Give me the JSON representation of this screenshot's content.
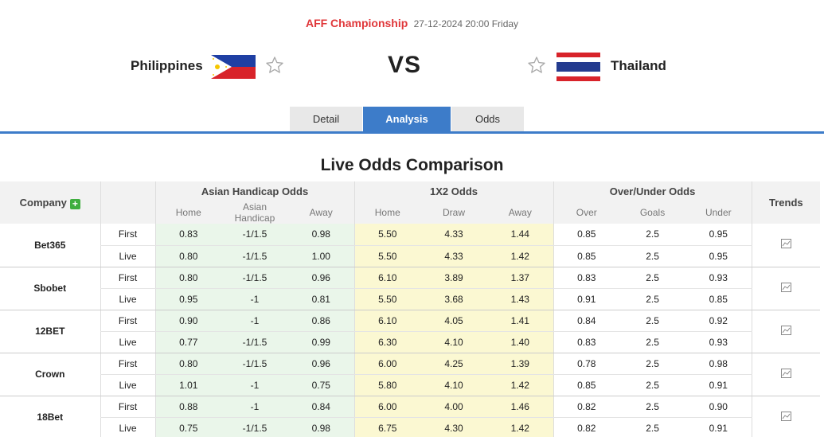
{
  "match": {
    "league": "AFF Championship",
    "datetime": "27-12-2024 20:00 Friday",
    "home_team": "Philippines",
    "away_team": "Thailand",
    "vs": "VS"
  },
  "tabs": [
    {
      "label": "Detail",
      "active": false
    },
    {
      "label": "Analysis",
      "active": true
    },
    {
      "label": "Odds",
      "active": false
    }
  ],
  "section_title": "Live Odds Comparison",
  "table": {
    "company_header": "Company",
    "trends_header": "Trends",
    "groups": {
      "asian_handicap": "Asian Handicap Odds",
      "x12": "1X2 Odds",
      "over_under": "Over/Under Odds"
    },
    "subheaders": {
      "ah": [
        "Home",
        "Asian Handicap",
        "Away"
      ],
      "x12": [
        "Home",
        "Draw",
        "Away"
      ],
      "ou": [
        "Over",
        "Goals",
        "Under"
      ]
    },
    "companies": [
      {
        "name": "Bet365",
        "rows": [
          {
            "type": "First",
            "ah": [
              "0.83",
              "-1/1.5",
              "0.98"
            ],
            "x12": [
              "5.50",
              "4.33",
              "1.44"
            ],
            "ou": [
              "0.85",
              "2.5",
              "0.95"
            ]
          },
          {
            "type": "Live",
            "ah": [
              "0.80",
              "-1/1.5",
              "1.00"
            ],
            "x12": [
              "5.50",
              "4.33",
              "1.42"
            ],
            "ou": [
              "0.85",
              "2.5",
              "0.95"
            ]
          }
        ]
      },
      {
        "name": "Sbobet",
        "rows": [
          {
            "type": "First",
            "ah": [
              "0.80",
              "-1/1.5",
              "0.96"
            ],
            "x12": [
              "6.10",
              "3.89",
              "1.37"
            ],
            "ou": [
              "0.83",
              "2.5",
              "0.93"
            ]
          },
          {
            "type": "Live",
            "ah": [
              "0.95",
              "-1",
              "0.81"
            ],
            "x12": [
              "5.50",
              "3.68",
              "1.43"
            ],
            "ou": [
              "0.91",
              "2.5",
              "0.85"
            ]
          }
        ]
      },
      {
        "name": "12BET",
        "rows": [
          {
            "type": "First",
            "ah": [
              "0.90",
              "-1",
              "0.86"
            ],
            "x12": [
              "6.10",
              "4.05",
              "1.41"
            ],
            "ou": [
              "0.84",
              "2.5",
              "0.92"
            ]
          },
          {
            "type": "Live",
            "ah": [
              "0.77",
              "-1/1.5",
              "0.99"
            ],
            "x12": [
              "6.30",
              "4.10",
              "1.40"
            ],
            "ou": [
              "0.83",
              "2.5",
              "0.93"
            ]
          }
        ]
      },
      {
        "name": "Crown",
        "rows": [
          {
            "type": "First",
            "ah": [
              "0.80",
              "-1/1.5",
              "0.96"
            ],
            "x12": [
              "6.00",
              "4.25",
              "1.39"
            ],
            "ou": [
              "0.78",
              "2.5",
              "0.98"
            ]
          },
          {
            "type": "Live",
            "ah": [
              "1.01",
              "-1",
              "0.75"
            ],
            "x12": [
              "5.80",
              "4.10",
              "1.42"
            ],
            "ou": [
              "0.85",
              "2.5",
              "0.91"
            ]
          }
        ]
      },
      {
        "name": "18Bet",
        "rows": [
          {
            "type": "First",
            "ah": [
              "0.88",
              "-1",
              "0.84"
            ],
            "x12": [
              "6.00",
              "4.00",
              "1.46"
            ],
            "ou": [
              "0.82",
              "2.5",
              "0.90"
            ]
          },
          {
            "type": "Live",
            "ah": [
              "0.75",
              "-1/1.5",
              "0.98"
            ],
            "x12": [
              "6.75",
              "4.30",
              "1.42"
            ],
            "ou": [
              "0.82",
              "2.5",
              "0.91"
            ]
          }
        ]
      }
    ]
  },
  "colors": {
    "accent": "#3d7cc9",
    "league": "#e0373a",
    "ah_bg": "#eaf6ea",
    "x12_bg": "#fbf8d2",
    "plus": "#3fae3f"
  }
}
